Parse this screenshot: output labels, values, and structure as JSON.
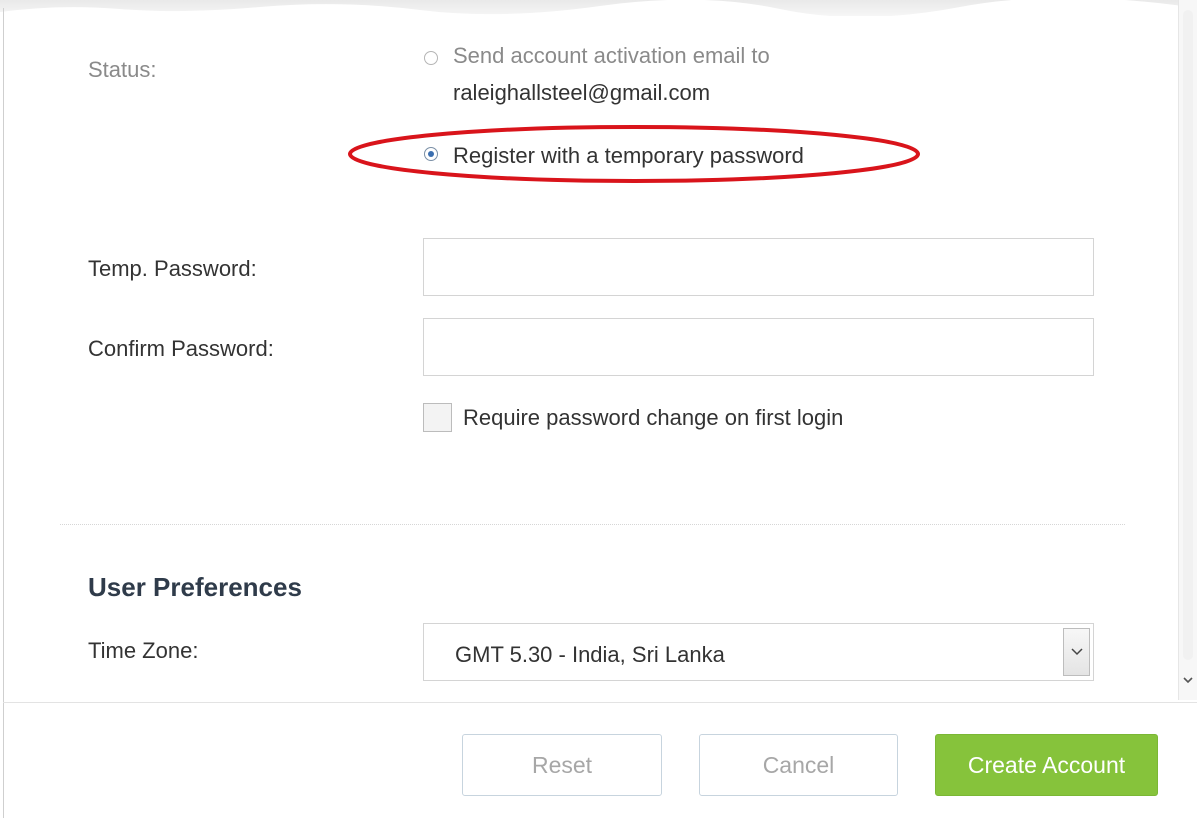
{
  "status": {
    "label": "Status:",
    "options": [
      {
        "line1": "Send account activation email to",
        "line2": "raleighallsteel@gmail.com",
        "checked": false
      },
      {
        "label": "Register with a temporary password",
        "checked": true
      }
    ]
  },
  "temp_password": {
    "label": "Temp. Password:",
    "value": ""
  },
  "confirm_password": {
    "label": "Confirm Password:",
    "value": ""
  },
  "require_change": {
    "label": "Require password change on first login",
    "checked": false
  },
  "user_preferences": {
    "title": "User Preferences",
    "time_zone": {
      "label": "Time Zone:",
      "value": "GMT 5.30 - India, Sri Lanka"
    }
  },
  "footer": {
    "reset_label": "Reset",
    "cancel_label": "Cancel",
    "create_label": "Create Account"
  },
  "colors": {
    "accent_green": "#86c33b",
    "highlight_red": "#d9141b",
    "radio_blue": "#3b6fb0"
  }
}
